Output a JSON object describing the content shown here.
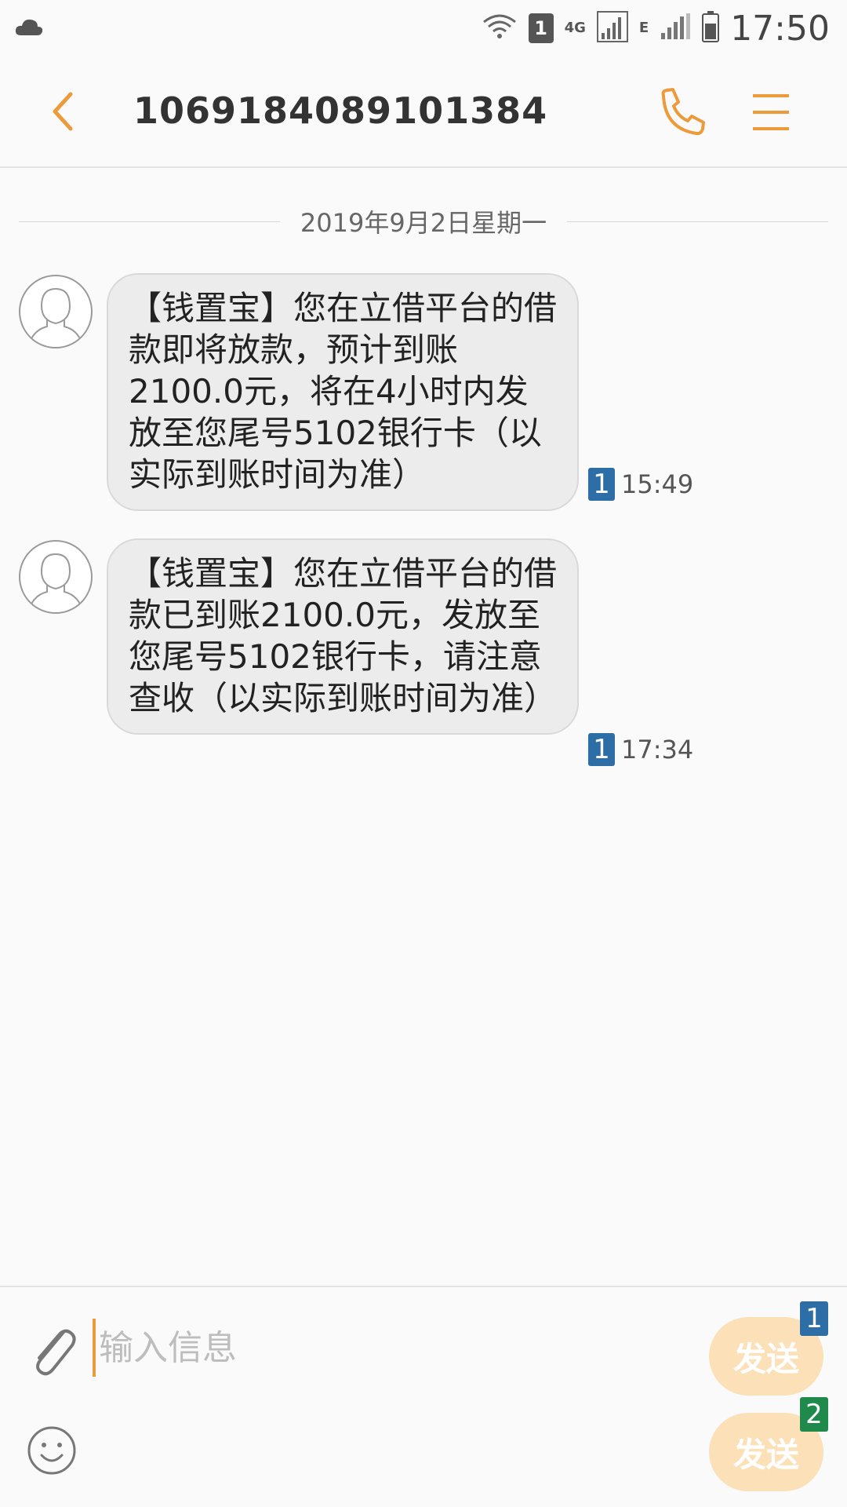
{
  "status_bar": {
    "sim_number": "1",
    "network_4g": "4G",
    "network_e": "E",
    "time": "17:50"
  },
  "header": {
    "title": "1069184089101384"
  },
  "conversation": {
    "date": "2019年9月2日星期一",
    "messages": [
      {
        "text": "【钱置宝】您在立借平台的借款即将放款，预计到账2100.0元，将在4小时内发放至您尾号5102银行卡（以实际到账时间为准）",
        "sim": "1",
        "time": "15:49"
      },
      {
        "text": "【钱置宝】您在立借平台的借款已到账2100.0元，发放至您尾号5102银行卡，请注意查收（以实际到账时间为准）",
        "sim": "1",
        "time": "17:34"
      }
    ]
  },
  "composer": {
    "placeholder": "输入信息",
    "send_buttons": [
      {
        "label": "发送",
        "sim": "1",
        "color": "#2e6ea6"
      },
      {
        "label": "发送",
        "sim": "2",
        "color": "#1f8a4c"
      }
    ]
  },
  "colors": {
    "accent": "#ec9a3a",
    "bubble": "#ececec",
    "send_disabled": "#fbe0b8"
  }
}
